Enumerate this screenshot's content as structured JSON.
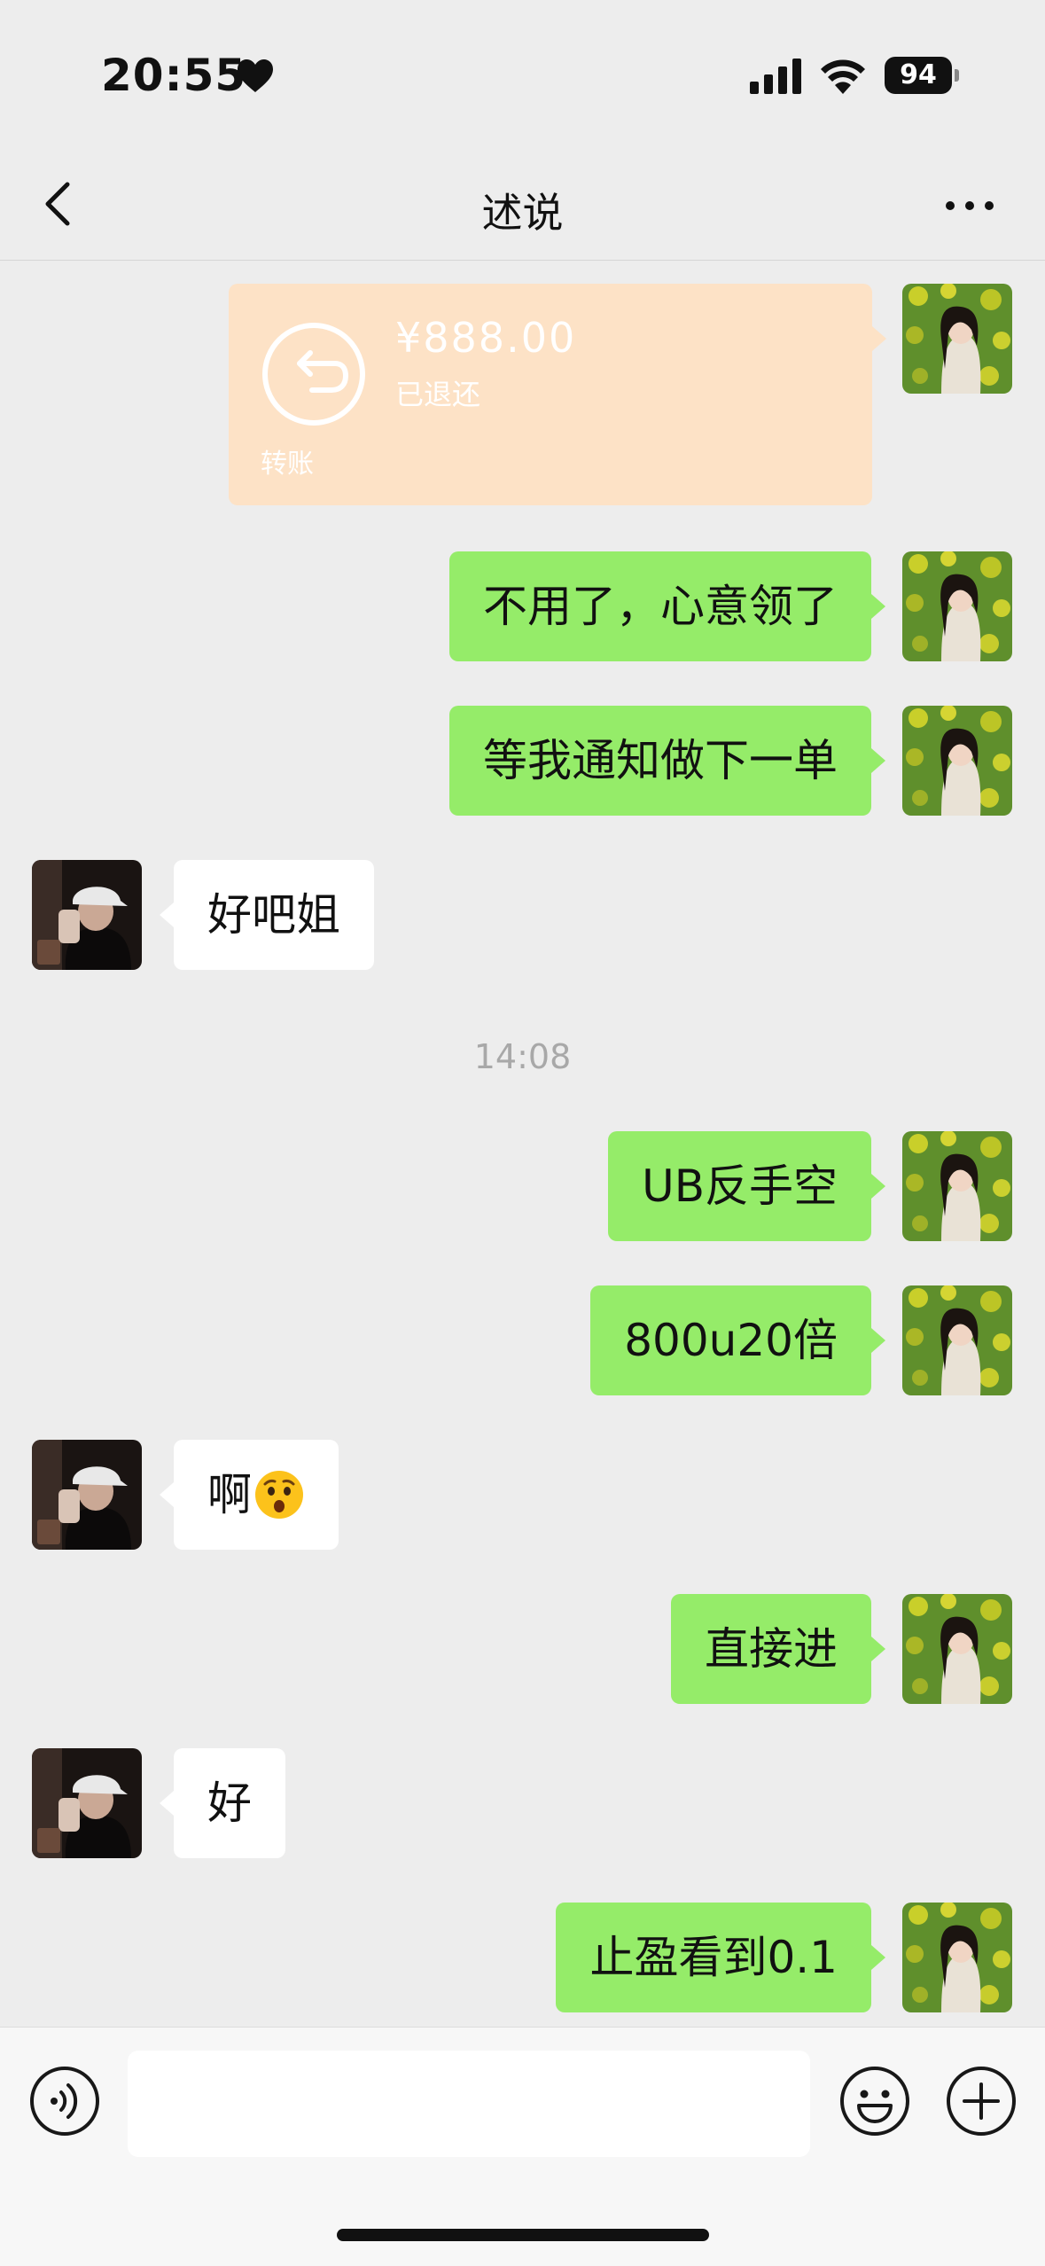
{
  "status_bar": {
    "time": "20:55",
    "battery": "94"
  },
  "header": {
    "title": "述说"
  },
  "transfer": {
    "amount": "¥888.00",
    "status": "已退还",
    "label": "转账"
  },
  "messages": [
    {
      "from": "me",
      "text": "不用了，心意领了"
    },
    {
      "from": "me",
      "text": "等我通知做下一单"
    },
    {
      "from": "other",
      "text": "好吧姐"
    },
    {
      "from": "me",
      "text": "UB反手空"
    },
    {
      "from": "me",
      "text": "800u20倍"
    },
    {
      "from": "other",
      "text": "啊",
      "emoji": "astonished-face"
    },
    {
      "from": "me",
      "text": "直接进"
    },
    {
      "from": "other",
      "text": "好"
    },
    {
      "from": "me",
      "text": "止盈看到0.1"
    }
  ],
  "timestamp": "14:08",
  "input": {
    "value": "",
    "placeholder": ""
  },
  "icons": {
    "back": "chevron-left-icon",
    "more": "more-icon",
    "voice": "voice-icon",
    "emoji": "smiley-icon",
    "plus": "plus-icon"
  },
  "colors": {
    "background": "#ededed",
    "my_bubble": "#95ec69",
    "their_bubble": "#ffffff",
    "transfer_card": "#fde2c6",
    "timestamp_text": "#a8a8a8"
  }
}
